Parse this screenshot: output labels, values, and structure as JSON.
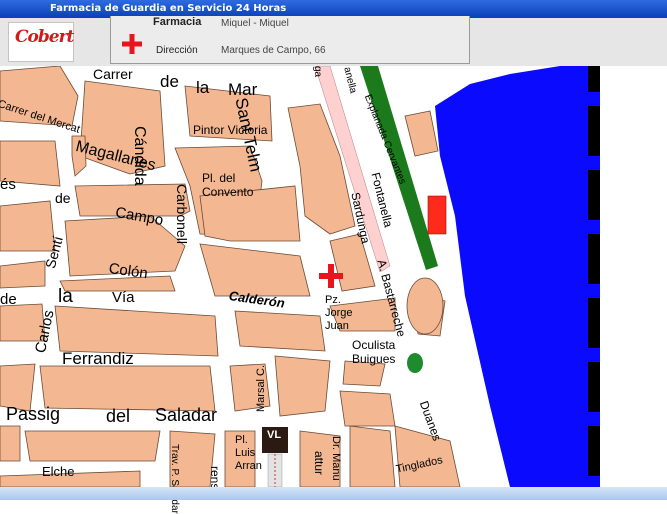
{
  "window": {
    "title": "Farmacia de Guardia en Servicio 24 Horas"
  },
  "brand": {
    "logo_text": "Cobert"
  },
  "info": {
    "pharmacy_label": "Farmacia",
    "pharmacy_value": "Miquel - Miquel",
    "address_label": "Dirección",
    "address_value": "Marques de Campo, 66"
  },
  "map": {
    "labels": {
      "carrer_de_la_mar_1": "Carrer",
      "carrer_de_la_mar_2": "de",
      "carrer_de_la_mar_3": "la",
      "carrer_de_la_mar_4": "Mar",
      "carrer_del_mercat": "Carrer del Mercat",
      "candida": "Cándida",
      "sant_telm": "Sant Telm",
      "pintor_victoria": "Pintor Victoria",
      "magallanes": "Magallanes",
      "pl_del_convento": "Pl. del Convento",
      "carbonell": "Carbonell",
      "campo": "Campo",
      "marques_es": "és",
      "marques_de": "de",
      "sentf": "Sentí",
      "colon": "Colón",
      "de_la_via_1": "de",
      "de_la_via_2": "la",
      "de_la_via_3": "Vía",
      "calderon": "Calderón",
      "pz_jorge_juan": "Pz. Jorge Juan",
      "carlos": "Carlos",
      "ferrandiz": "Ferrandiz",
      "passig_1": "Passig",
      "passig_2": "del",
      "passig_3": "Saladar",
      "marsal": "Marsal C.",
      "oculista_buigues": "Oculista Buigues",
      "elche": "Elche",
      "trav_p_saladar": "Trav. P. Saladar",
      "pl_luis_arran": "Pl. Luis Arran",
      "dr_manu": "Dr. Manu",
      "tinglados": "Tinglados",
      "duanes": "Duanes",
      "a_bastarreche": "A. Bastarreche",
      "sardunga": "Sardunga",
      "fontanella": "Fontanella",
      "explanada_cervantes": "Explanada Cervantes",
      "o_bullet": "o",
      "ga": "ga",
      "anella": "anella",
      "rens": "rens",
      "attur": "attur"
    },
    "marker": {
      "icon": "pharmacy-cross-icon"
    },
    "metro": {
      "icon": "metro-station-icon",
      "text": "VL"
    }
  },
  "colors": {
    "title_bar": "#0a3fb8",
    "block": "#f3b891",
    "sea": "#0a0aff",
    "park": "#1b7a1b",
    "promenade": "#ffd0d0",
    "cross": "#e8161c",
    "red_rect": "#ff2a1a",
    "green_circle": "#1e8c2e"
  }
}
